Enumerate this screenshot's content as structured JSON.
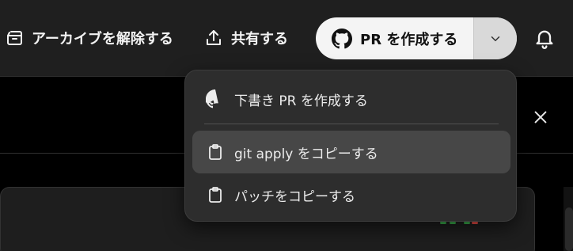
{
  "toolbar": {
    "unarchive_label": "アーカイブを解除する",
    "share_label": "共有する",
    "create_pr_label": "PR を作成する"
  },
  "menu": {
    "items": [
      {
        "label": "下書き PR を作成する",
        "icon": "github-icon"
      },
      {
        "label": "git apply をコピーする",
        "icon": "clipboard-icon",
        "highlighted": true
      },
      {
        "label": "パッチをコピーする",
        "icon": "clipboard-icon"
      }
    ]
  },
  "colors": {
    "topbar_bg": "#1f1f1f",
    "menu_bg": "#2d2d2d",
    "menu_highlight": "#474747",
    "pr_button_bg": "#f4f4f4"
  }
}
